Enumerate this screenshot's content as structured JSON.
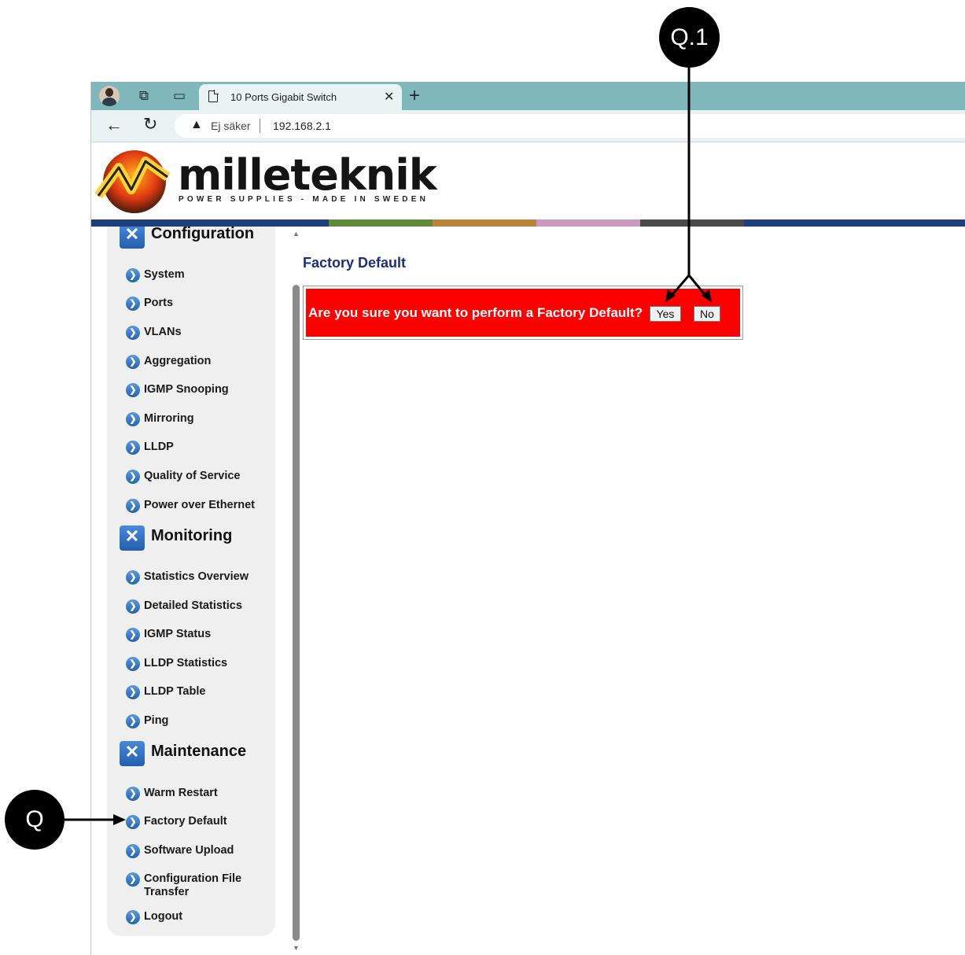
{
  "browser": {
    "tab_title": "10 Ports Gigabit Switch",
    "close_glyph": "✕",
    "newtab_glyph": "+",
    "back_glyph": "←",
    "reload_glyph": "↻",
    "warn_glyph": "▲",
    "security_label": "Ej säker",
    "url": "192.168.2.1"
  },
  "logo": {
    "name": "milleteknik",
    "tagline": "POWER SUPPLIES - MADE IN SWEDEN"
  },
  "sidebar": {
    "sections": [
      {
        "title": "Configuration",
        "items": [
          "System",
          "Ports",
          "VLANs",
          "Aggregation",
          "IGMP Snooping",
          "Mirroring",
          "LLDP",
          "Quality of Service",
          "Power over Ethernet"
        ]
      },
      {
        "title": "Monitoring",
        "items": [
          "Statistics Overview",
          "Detailed Statistics",
          "IGMP Status",
          "LLDP Statistics",
          "LLDP Table",
          "Ping"
        ]
      },
      {
        "title": "Maintenance",
        "items": [
          "Warm Restart",
          "Factory Default",
          "Software Upload",
          "Configuration File Transfer",
          "Logout"
        ]
      }
    ]
  },
  "content": {
    "title": "Factory Default",
    "prompt": "Are you sure you want to perform a Factory Default?",
    "yes_label": "Yes",
    "no_label": "No"
  },
  "annotations": {
    "q1": "Q.1",
    "q": "Q"
  },
  "colors": {
    "alert_bg": "#ff0000",
    "title_blue": "#1a2f7a",
    "tab_bar": "#7fb7bd"
  }
}
